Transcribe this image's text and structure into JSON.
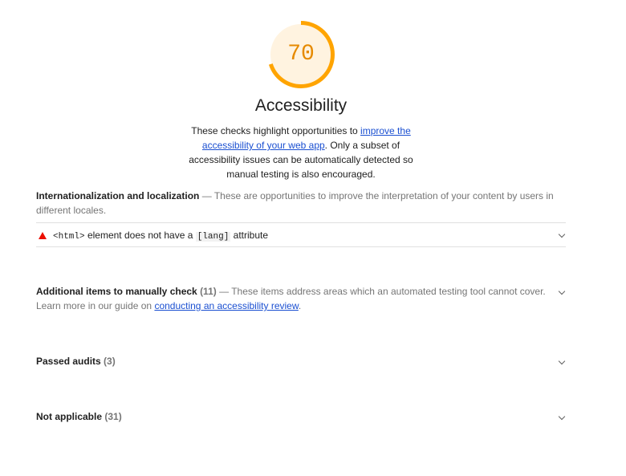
{
  "score": {
    "value": "70",
    "fraction": 0.7,
    "ring_color": "#ffa400",
    "fill_color": "#fff3e0",
    "text_color": "#e68a00"
  },
  "category": {
    "title": "Accessibility",
    "desc_before": "These checks highlight opportunities to ",
    "desc_link": "improve the accessibility of your web app",
    "desc_after": ". Only a subset of accessibility issues can be automatically detected so manual testing is also encouraged."
  },
  "groups": {
    "i18n": {
      "title": "Internationalization and localization",
      "separator": " — ",
      "description": "These are opportunities to improve the interpretation of your content by users in different locales."
    },
    "manual": {
      "title": "Additional items to manually check",
      "count": "(11)",
      "separator": " — ",
      "description_before": "These items address areas which an automated testing tool cannot cover. Learn more in our guide on ",
      "link": "conducting an accessibility review",
      "description_after": "."
    },
    "passed": {
      "title": "Passed audits",
      "count": "(3)"
    },
    "not_applicable": {
      "title": "Not applicable",
      "count": "(31)"
    }
  },
  "audits": {
    "html_lang": {
      "code_html": "<html>",
      "text_middle": " element does not have a ",
      "code_lang": "[lang]",
      "text_end": " attribute",
      "status_icon": "fail-triangle-icon",
      "status_color": "#eb0f00"
    }
  },
  "icons": {
    "chevron": "chevron-down-icon"
  }
}
